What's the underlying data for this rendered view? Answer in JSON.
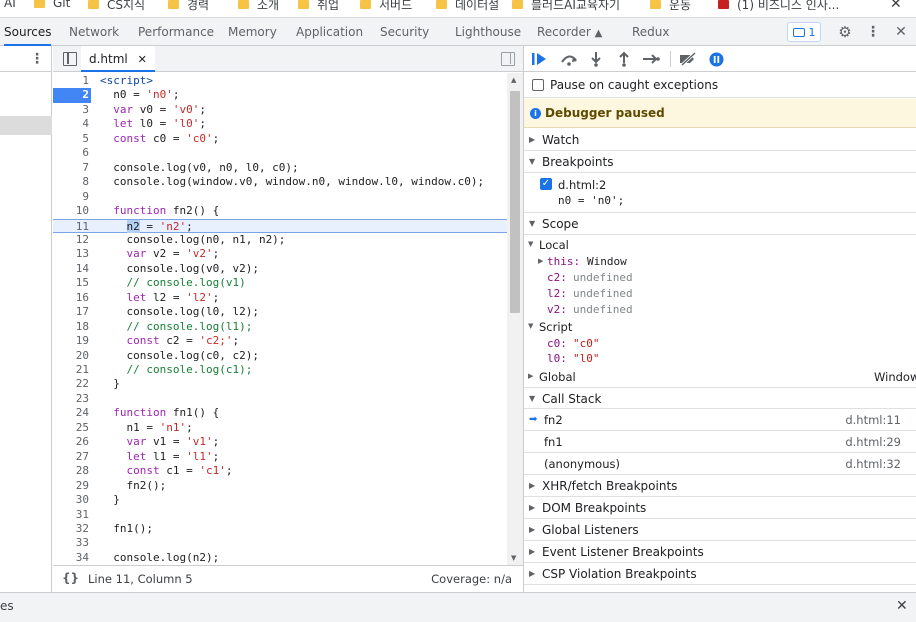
{
  "bookmarks": [
    "AI",
    "Git",
    "CS지식",
    "경력",
    "소개",
    "취업",
    "서버드",
    "데이터설",
    "블러드AI교육자기",
    "운동",
    "(1) 비즈니스 인사..."
  ],
  "devtools_tabs": [
    "Sources",
    "Network",
    "Performance",
    "Memory",
    "Application",
    "Security",
    "Lighthouse",
    "Recorder",
    "Redux"
  ],
  "issues_count": "1",
  "editor": {
    "file_tab": "d.html",
    "status_position": "Line 11, Column 5",
    "status_coverage": "Coverage: n/a",
    "lines": [
      {
        "n": "1",
        "t": "<script>"
      },
      {
        "n": "2",
        "t": "  n0 = 'n0';"
      },
      {
        "n": "3",
        "t": "  var v0 = 'v0';"
      },
      {
        "n": "4",
        "t": "  let l0 = 'l0';"
      },
      {
        "n": "5",
        "t": "  const c0 = 'c0';"
      },
      {
        "n": "6",
        "t": ""
      },
      {
        "n": "7",
        "t": "  console.log(v0, n0, l0, c0);"
      },
      {
        "n": "8",
        "t": "  console.log(window.v0, window.n0, window.l0, window.c0);"
      },
      {
        "n": "9",
        "t": ""
      },
      {
        "n": "10",
        "t": "  function fn2() {"
      },
      {
        "n": "11",
        "t": "    n2 = 'n2';"
      },
      {
        "n": "12",
        "t": "    console.log(n0, n1, n2);"
      },
      {
        "n": "13",
        "t": "    var v2 = 'v2';"
      },
      {
        "n": "14",
        "t": "    console.log(v0, v2);"
      },
      {
        "n": "15",
        "t": "    // console.log(v1)"
      },
      {
        "n": "16",
        "t": "    let l2 = 'l2';"
      },
      {
        "n": "17",
        "t": "    console.log(l0, l2);"
      },
      {
        "n": "18",
        "t": "    // console.log(l1);"
      },
      {
        "n": "19",
        "t": "    const c2 = 'c2;';"
      },
      {
        "n": "20",
        "t": "    console.log(c0, c2);"
      },
      {
        "n": "21",
        "t": "    // console.log(c1);"
      },
      {
        "n": "22",
        "t": "  }"
      },
      {
        "n": "23",
        "t": ""
      },
      {
        "n": "24",
        "t": "  function fn1() {"
      },
      {
        "n": "25",
        "t": "    n1 = 'n1';"
      },
      {
        "n": "26",
        "t": "    var v1 = 'v1';"
      },
      {
        "n": "27",
        "t": "    let l1 = 'l1';"
      },
      {
        "n": "28",
        "t": "    const c1 = 'c1';"
      },
      {
        "n": "29",
        "t": "    fn2();"
      },
      {
        "n": "30",
        "t": "  }"
      },
      {
        "n": "31",
        "t": ""
      },
      {
        "n": "32",
        "t": "  fn1();"
      },
      {
        "n": "33",
        "t": ""
      },
      {
        "n": "34",
        "t": "  console.log(n2);"
      }
    ]
  },
  "debugger": {
    "pause_on_caught": "Pause on caught exceptions",
    "paused_banner": "Debugger paused",
    "watch": "Watch",
    "breakpoints": "Breakpoints",
    "bp_file": "d.html:2",
    "bp_code": "n0 = 'n0';",
    "scope": "Scope",
    "local": "Local",
    "this_key": "this:",
    "this_val": "Window",
    "locals": [
      {
        "k": "c2:",
        "v": "undefined"
      },
      {
        "k": "l2:",
        "v": "undefined"
      },
      {
        "k": "v2:",
        "v": "undefined"
      }
    ],
    "script": "Script",
    "script_vars": [
      {
        "k": "c0:",
        "v": "\"c0\""
      },
      {
        "k": "l0:",
        "v": "\"l0\""
      }
    ],
    "global": "Global",
    "global_val": "Window",
    "call_stack": "Call Stack",
    "frames": [
      {
        "fn": "fn2",
        "loc": "d.html:11"
      },
      {
        "fn": "fn1",
        "loc": "d.html:29"
      },
      {
        "fn": "(anonymous)",
        "loc": "d.html:32"
      }
    ],
    "sections": [
      "XHR/fetch Breakpoints",
      "DOM Breakpoints",
      "Global Listeners",
      "Event Listener Breakpoints",
      "CSP Violation Breakpoints"
    ]
  },
  "bottom_label": "es"
}
